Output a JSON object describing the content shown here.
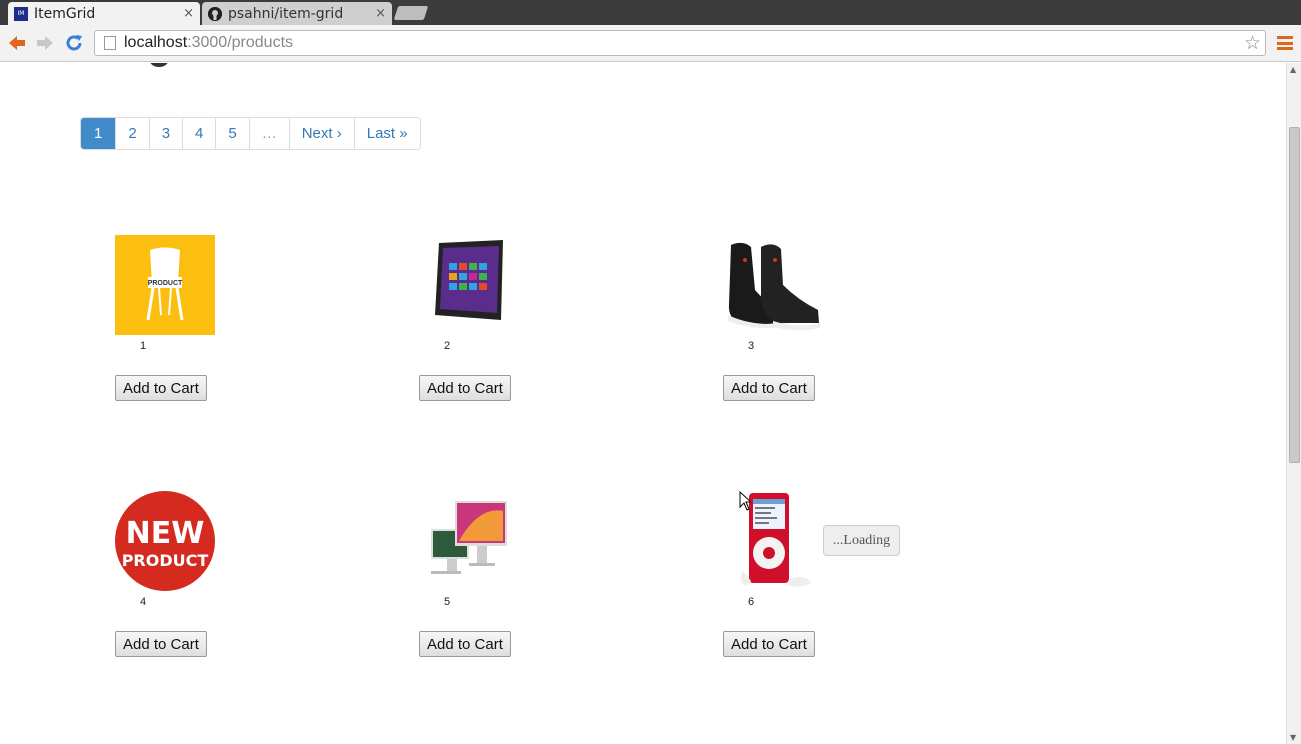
{
  "browser": {
    "tabs": [
      {
        "title": "ItemGrid",
        "favicon": "IM",
        "active": true
      },
      {
        "title": "psahni/item-grid",
        "active": false
      }
    ],
    "close_glyph": "×",
    "url_host": "localhost",
    "url_path": ":3000/products"
  },
  "pagination": {
    "pages": [
      "1",
      "2",
      "3",
      "4",
      "5"
    ],
    "ellipsis": "…",
    "next": "Next ›",
    "last": "Last »",
    "active_page": "1"
  },
  "products": [
    {
      "id": "1",
      "image": "chair-product-image",
      "button": "Add to Cart"
    },
    {
      "id": "2",
      "image": "tablet-image",
      "button": "Add to Cart"
    },
    {
      "id": "3",
      "image": "sneakers-image",
      "button": "Add to Cart"
    },
    {
      "id": "4",
      "image": "new-product-badge-image",
      "button": "Add to Cart"
    },
    {
      "id": "5",
      "image": "computers-image",
      "button": "Add to Cart"
    },
    {
      "id": "6",
      "image": "ipod-image",
      "button": "Add to Cart"
    }
  ],
  "loading_label": "...Loading",
  "chair_text": "PRODUCT",
  "badge_text": {
    "line1": "NEW",
    "line2": "PRODUCT"
  },
  "colors": {
    "accent": "#428bca",
    "link": "#337ab7",
    "chair_bg": "#fdbf0f",
    "badge_red": "#d42a1f",
    "ipod_red": "#d0102a"
  }
}
